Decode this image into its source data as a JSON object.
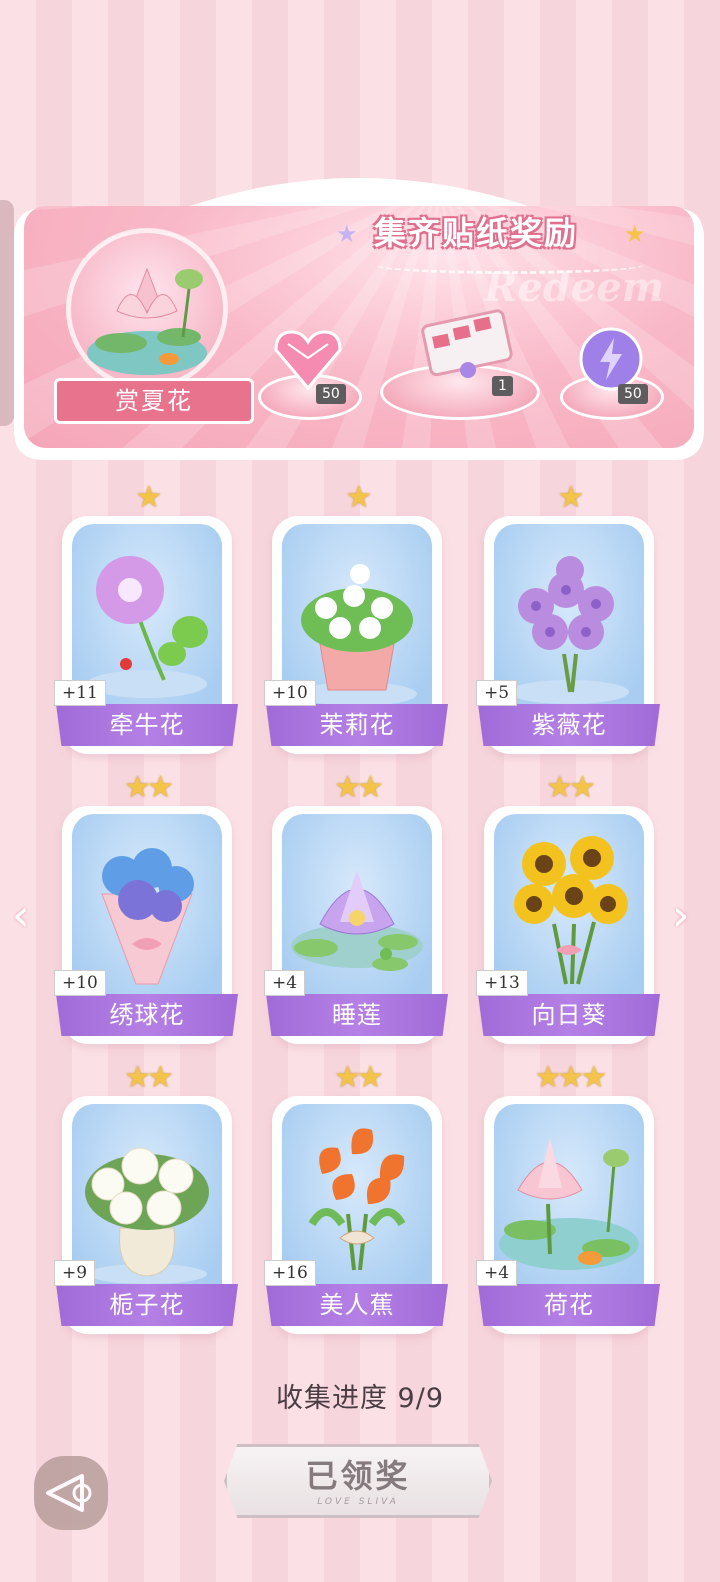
{
  "banner": {
    "title": "集齐贴纸奖励",
    "watermark": "Redeem",
    "theme_name": "赏夏花",
    "rewards": [
      {
        "icon": "pink-diamond-icon",
        "count": "50"
      },
      {
        "icon": "gift-box-icon",
        "count": "1"
      },
      {
        "icon": "energy-orb-icon",
        "count": "50"
      }
    ]
  },
  "cards": [
    {
      "name": "牵牛花",
      "count": "+11",
      "stars": "★"
    },
    {
      "name": "茉莉花",
      "count": "+10",
      "stars": "★"
    },
    {
      "name": "紫薇花",
      "count": "+5",
      "stars": "★"
    },
    {
      "name": "绣球花",
      "count": "+10",
      "stars": "★★"
    },
    {
      "name": "睡莲",
      "count": "+4",
      "stars": "★★"
    },
    {
      "name": "向日葵",
      "count": "+13",
      "stars": "★★"
    },
    {
      "name": "栀子花",
      "count": "+9",
      "stars": "★★"
    },
    {
      "name": "美人蕉",
      "count": "+16",
      "stars": "★★"
    },
    {
      "name": "荷花",
      "count": "+4",
      "stars": "★★★"
    }
  ],
  "progress": "收集进度  9/9",
  "claim_button": {
    "label": "已领奖",
    "sub": "LOVE SLIVA"
  },
  "nav": {
    "prev": "‹",
    "next": "›"
  },
  "colors": {
    "ribbon": "#a06bd8",
    "banner": "#f5a6b8",
    "card_bg": "#a8cdf1"
  }
}
